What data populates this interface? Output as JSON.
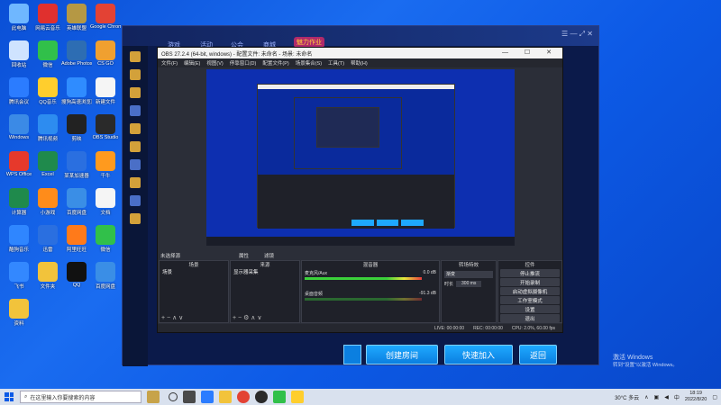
{
  "desktop_icons": [
    {
      "label": "此电脑",
      "color": "#6fb7ff"
    },
    {
      "label": "网易云音乐",
      "color": "#e0302e"
    },
    {
      "label": "英雄联盟",
      "color": "#b59844"
    },
    {
      "label": "Google Chrome",
      "color": "#e34234"
    },
    {
      "label": "回收站",
      "color": "#cfe3ff"
    },
    {
      "label": "微信",
      "color": "#31c04a"
    },
    {
      "label": "Adobe Photoshop",
      "color": "#2d6db3"
    },
    {
      "label": "CS GO",
      "color": "#f0a030"
    },
    {
      "label": "腾讯会议",
      "color": "#2b7cff"
    },
    {
      "label": "QQ音乐",
      "color": "#ffce2d"
    },
    {
      "label": "搜狗高速浏览器",
      "color": "#2f8cff"
    },
    {
      "label": "新建文件",
      "color": "#f5f5f5"
    },
    {
      "label": "Windows",
      "color": "#3b8ae6"
    },
    {
      "label": "腾讯视频",
      "color": "#2d8cf0"
    },
    {
      "label": "剪映",
      "color": "#222222"
    },
    {
      "label": "OBS Studio",
      "color": "#2a2a2a"
    },
    {
      "label": "WPS Office",
      "color": "#e6392b"
    },
    {
      "label": "Excel",
      "color": "#1f8a4c"
    },
    {
      "label": "某某加速器",
      "color": "#2a6fe0"
    },
    {
      "label": "千牛",
      "color": "#ff9a1e"
    },
    {
      "label": "计算器",
      "color": "#1f8a4c"
    },
    {
      "label": "小游戏",
      "color": "#ff8c1a"
    },
    {
      "label": "百度网盘",
      "color": "#3a8ee6"
    },
    {
      "label": "文档",
      "color": "#f5f5f5"
    },
    {
      "label": "酷狗音乐",
      "color": "#2f86ff"
    },
    {
      "label": "迅雷",
      "color": "#2a6fe0"
    },
    {
      "label": "阿里旺旺",
      "color": "#ff7a1a"
    },
    {
      "label": "微信",
      "color": "#31c04a"
    },
    {
      "label": "飞书",
      "color": "#3388ff"
    },
    {
      "label": "文件夹",
      "color": "#f2c33b"
    },
    {
      "label": "QQ",
      "color": "#111111"
    },
    {
      "label": "百度网盘",
      "color": "#3a8ee6"
    },
    {
      "label": "资料",
      "color": "#f2c33b"
    }
  ],
  "game": {
    "tabs": [
      "游戏",
      "活动",
      "公会",
      "商城"
    ],
    "badge": "魅力作业",
    "controls": "☰ — ⤢ ✕",
    "buttons": {
      "create_room": "创建房间",
      "quick_join": "快速加入",
      "back": "返回"
    }
  },
  "obs": {
    "title": "OBS 27.2.4 (64-bit, windows) - 配置文件: 未命名 - 场景: 未命名",
    "window_controls": "— ☐ ✕",
    "menu": [
      "文件(F)",
      "编辑(E)",
      "视图(V)",
      "停靠窗口(D)",
      "配置文件(P)",
      "场景集合(S)",
      "工具(T)",
      "帮助(H)"
    ],
    "no_source_selected": "未选择源",
    "properties_label": "属性",
    "filters_label": "滤镜",
    "scenes_header": "场景",
    "scene_item": "场景",
    "sources_header": "来源",
    "source_item": "显示器采集",
    "mixer_header": "混音器",
    "mixer_channels": [
      {
        "name": "桌面音频",
        "db": "0.0 dB"
      },
      {
        "name": "麦克风/Aux",
        "db": "-91.3 dB"
      }
    ],
    "transitions_header": "转场特效",
    "transition_type": "渐变",
    "duration_label": "时长",
    "duration_value": "300 ms",
    "controls_header": "控件",
    "control_buttons": [
      "停止推流",
      "开始录制",
      "启动虚拟摄像机",
      "工作室模式",
      "设置",
      "退出"
    ],
    "status": {
      "live": "LIVE: 00:00:00",
      "rec": "REC: 00:00:00",
      "cpu": "CPU: 2.0%, 60.00 fps"
    }
  },
  "taskbar": {
    "search_placeholder": "在这里输入你要搜索的内容",
    "weather": "30°C 多云",
    "time": "18:19",
    "date": "2022/8/20"
  },
  "watermark": {
    "line1": "激活 Windows",
    "line2": "转到\"设置\"以激活 Windows。"
  }
}
